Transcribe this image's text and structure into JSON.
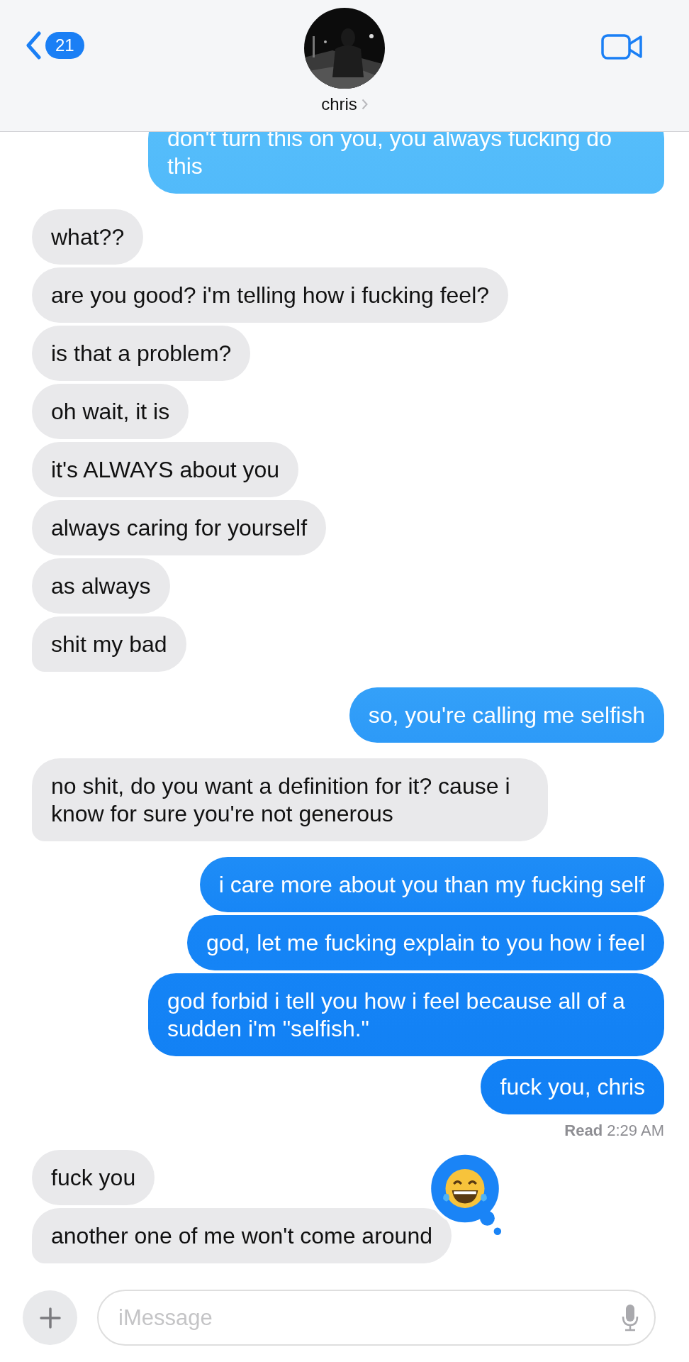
{
  "header": {
    "back_count": "21",
    "contact_name": "chris"
  },
  "messages": [
    {
      "kind": "sent",
      "text": "don't turn this on you, you always fucking do this",
      "tail": true
    },
    {
      "kind": "received",
      "text": "what??",
      "tail": false
    },
    {
      "kind": "received",
      "text": "are you good? i'm telling how i fucking feel?",
      "tail": false
    },
    {
      "kind": "received",
      "text": "is that a problem?",
      "tail": false
    },
    {
      "kind": "received",
      "text": "oh wait, it is",
      "tail": false
    },
    {
      "kind": "received",
      "text": "it's ALWAYS about you",
      "tail": false
    },
    {
      "kind": "received",
      "text": "always caring for yourself",
      "tail": false
    },
    {
      "kind": "received",
      "text": "as always",
      "tail": false
    },
    {
      "kind": "received",
      "text": "shit my bad",
      "tail": true
    },
    {
      "kind": "sent",
      "text": "so, you're calling me selfish",
      "tail": true
    },
    {
      "kind": "received",
      "text": "no shit, do you want a definition for it? cause i know for sure you're not generous",
      "tail": true
    },
    {
      "kind": "sent",
      "text": "i care more about you than my fucking self",
      "tail": false
    },
    {
      "kind": "sent",
      "text": "god, let me fucking explain to you how i feel",
      "tail": false
    },
    {
      "kind": "sent",
      "text": "god forbid i tell you how i feel because all of a sudden i'm \"selfish.\"",
      "tail": false
    },
    {
      "kind": "sent",
      "text": "fuck you, chris",
      "tail": true
    },
    {
      "kind": "receipt",
      "text": "**Read** 2:29 AM"
    },
    {
      "kind": "received",
      "text": "fuck you",
      "tail": false
    },
    {
      "kind": "received",
      "text": "another one of me won't come around",
      "tail": true,
      "reaction": {
        "kind": "laugh"
      }
    }
  ],
  "composer": {
    "placeholder": "iMessage"
  }
}
